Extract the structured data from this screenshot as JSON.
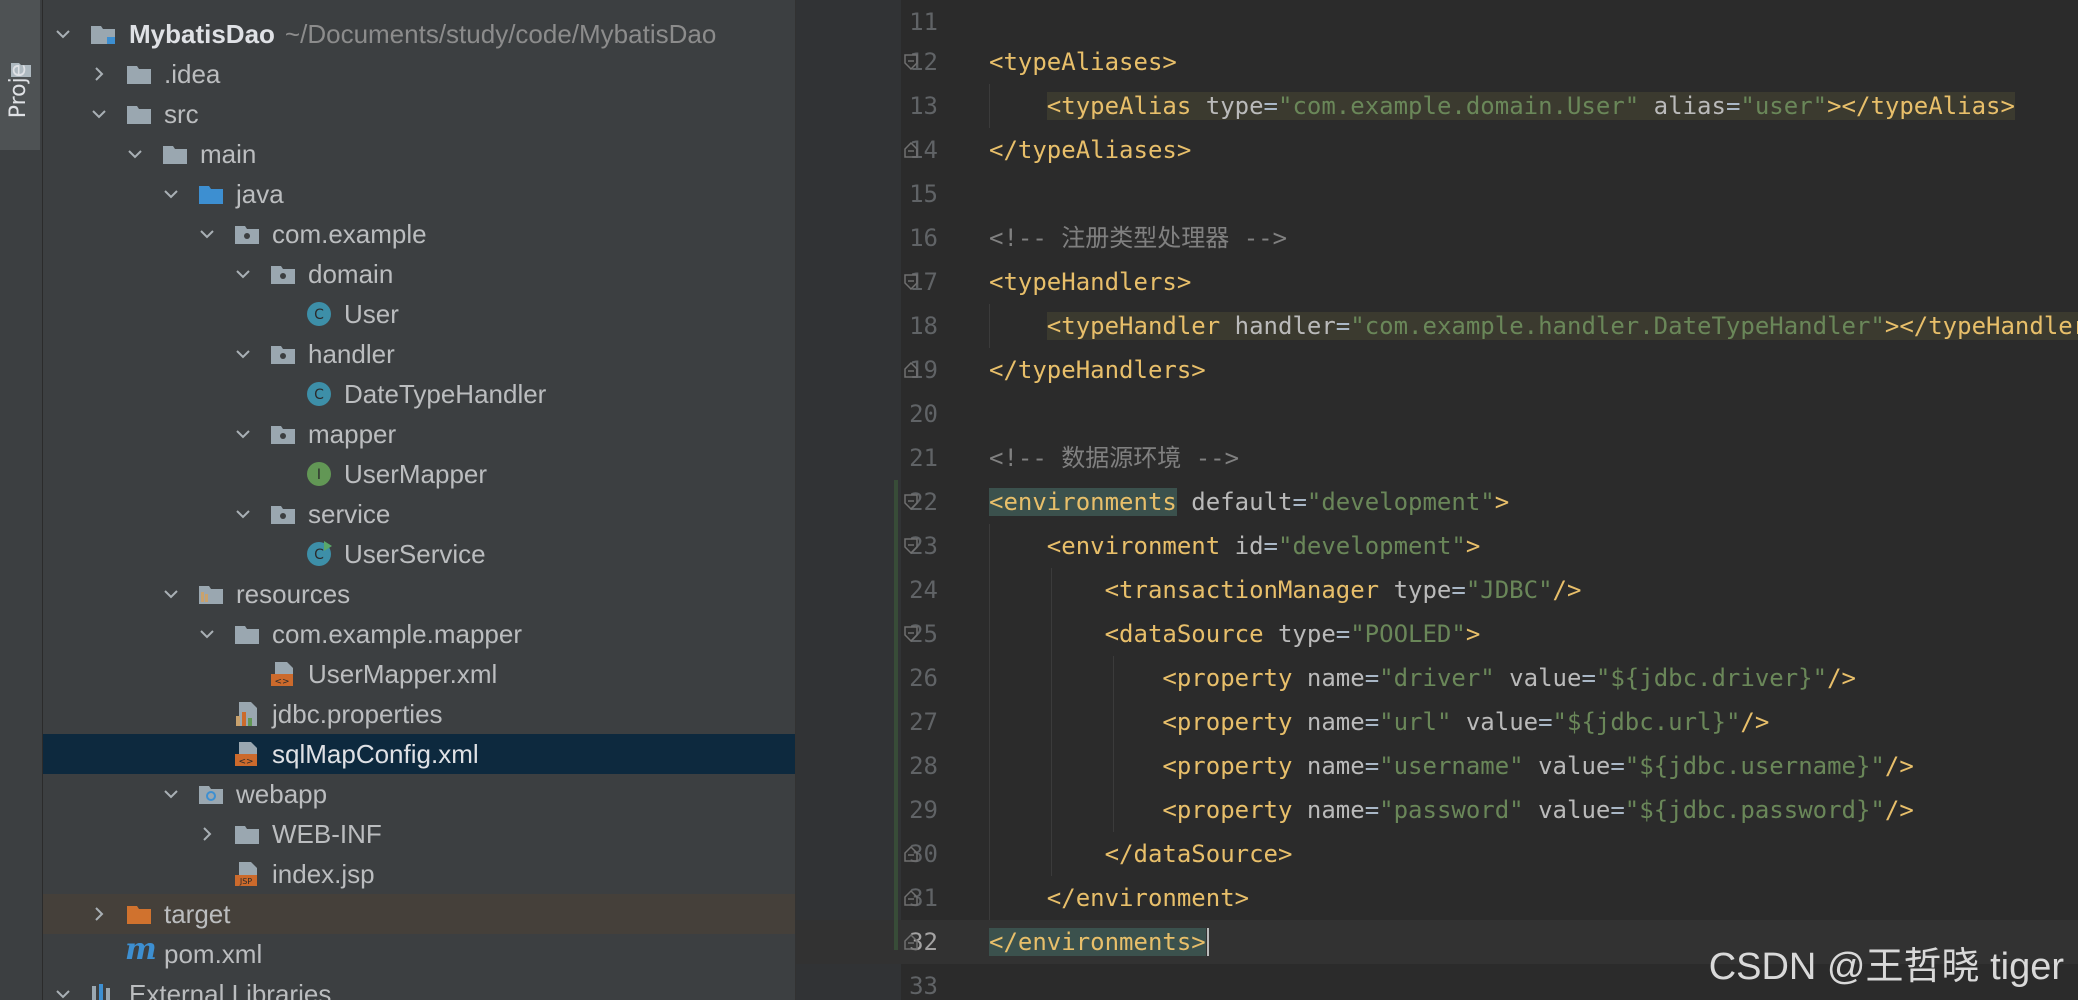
{
  "toolwindow": {
    "label": "Proje"
  },
  "project": {
    "name": "MybatisDao",
    "path": "~/Documents/study/code/MybatisDao"
  },
  "tree": [
    {
      "label": ".idea"
    },
    {
      "label": "src"
    },
    {
      "label": "main"
    },
    {
      "label": "java"
    },
    {
      "label": "com.example"
    },
    {
      "label": "domain"
    },
    {
      "label": "User"
    },
    {
      "label": "handler"
    },
    {
      "label": "DateTypeHandler"
    },
    {
      "label": "mapper"
    },
    {
      "label": "UserMapper"
    },
    {
      "label": "service"
    },
    {
      "label": "UserService"
    },
    {
      "label": "resources"
    },
    {
      "label": "com.example.mapper"
    },
    {
      "label": "UserMapper.xml"
    },
    {
      "label": "jdbc.properties"
    },
    {
      "label": "sqlMapConfig.xml"
    },
    {
      "label": "webapp"
    },
    {
      "label": "WEB-INF"
    },
    {
      "label": "index.jsp"
    },
    {
      "label": "target"
    },
    {
      "label": "pom.xml"
    },
    {
      "label": "External Libraries"
    }
  ],
  "editor": {
    "line_numbers": [
      "11",
      "12",
      "13",
      "14",
      "15",
      "16",
      "17",
      "18",
      "19",
      "20",
      "21",
      "22",
      "23",
      "24",
      "25",
      "26",
      "27",
      "28",
      "29",
      "30",
      "31",
      "32",
      "33"
    ],
    "current_line": "32",
    "comment_type_handlers": "<!-- 注册类型处理器 -->",
    "comment_datasource": "<!-- 数据源环境 -->",
    "alias_type": "\"com.example.domain.User\"",
    "alias_name": "\"user\"",
    "handler_class": "\"com.example.handler.DateTypeHandler\"",
    "env_default": "\"development\"",
    "env_id": "\"development\"",
    "tx_type": "\"JDBC\"",
    "ds_type": "\"POOLED\"",
    "props": [
      {
        "name": "\"driver\"",
        "value": "\"${jdbc.driver}\""
      },
      {
        "name": "\"url\"",
        "value": "\"${jdbc.url}\""
      },
      {
        "name": "\"username\"",
        "value": "\"${jdbc.username}\""
      },
      {
        "name": "\"password\"",
        "value": "\"${jdbc.password}\""
      }
    ]
  },
  "watermark": "CSDN @王哲晓 tiger",
  "colors": {
    "tag": "#e8bf6a",
    "attr": "#bababa",
    "string": "#6a8759",
    "comment": "#808080",
    "selection": "#0d293e"
  }
}
